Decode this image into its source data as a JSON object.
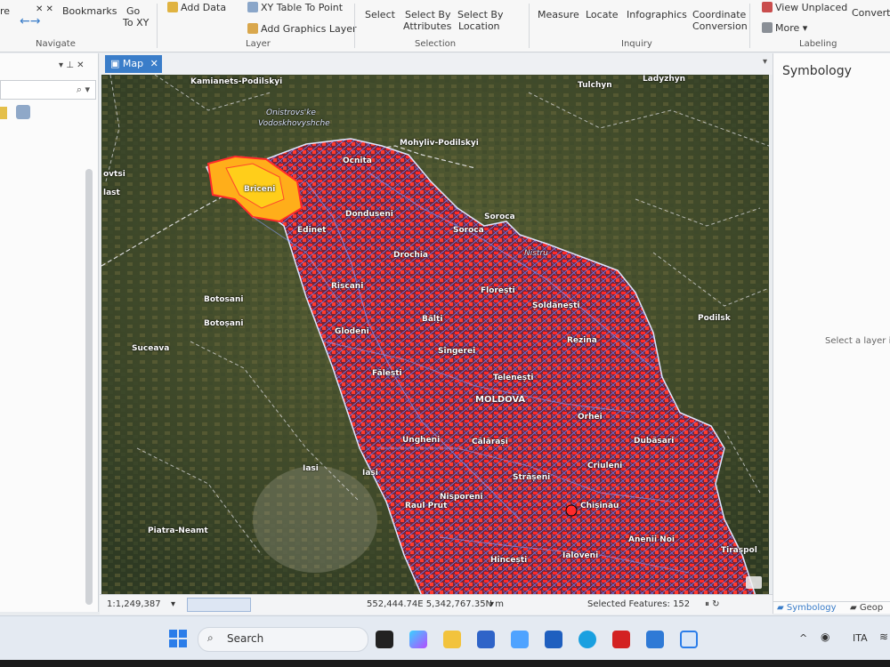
{
  "ribbon": {
    "navigate": {
      "bookmarks": "Bookmarks",
      "go_to_xy_1": "Go",
      "go_to_xy_2": "To XY",
      "group": "Navigate",
      "cut": "re"
    },
    "layer": {
      "add_data": "Add Data",
      "xy_table": "XY Table To Point",
      "add_graphics": "Add Graphics Layer",
      "group": "Layer"
    },
    "selection": {
      "select": "Select",
      "by_attr_1": "Select By",
      "by_attr_2": "Attributes",
      "by_loc_1": "Select By",
      "by_loc_2": "Location",
      "group": "Selection"
    },
    "inquiry": {
      "measure": "Measure",
      "locate": "Locate",
      "infographics": "Infographics",
      "coord_1": "Coordinate",
      "coord_2": "Conversion",
      "group": "Inquiry"
    },
    "labeling": {
      "view_unplaced": "View Unplaced",
      "more": "More",
      "convert": "Convert",
      "group": "Labeling"
    }
  },
  "map_tab": {
    "label": "Map"
  },
  "map_labels": [
    {
      "text": "Kamianets-Podilskyi"
    },
    {
      "text": "Onistrovs'ke"
    },
    {
      "text": "Vodoskhovyshche"
    },
    {
      "text": "Mohyliv-Podilskyi"
    },
    {
      "text": "Tulchyn"
    },
    {
      "text": "Ladyzhyn"
    },
    {
      "text": "Ocnita"
    },
    {
      "text": "Briceni"
    },
    {
      "text": "Donduseni"
    },
    {
      "text": "Soroca"
    },
    {
      "text": "Edinet"
    },
    {
      "text": "Soroca"
    },
    {
      "text": "Nistru"
    },
    {
      "text": "Drochia"
    },
    {
      "text": "Riscani"
    },
    {
      "text": "Florești"
    },
    {
      "text": "Șoldănești"
    },
    {
      "text": "Botosani"
    },
    {
      "text": "Botoșani"
    },
    {
      "text": "Bălți"
    },
    {
      "text": "Glodeni"
    },
    {
      "text": "Rezina"
    },
    {
      "text": "Podilsk"
    },
    {
      "text": "Suceava"
    },
    {
      "text": "Sîngerei"
    },
    {
      "text": "Fălești"
    },
    {
      "text": "Telenești"
    },
    {
      "text": "MOLDOVA"
    },
    {
      "text": "Orhei"
    },
    {
      "text": "Ungheni"
    },
    {
      "text": "Călărași"
    },
    {
      "text": "Dubăsari"
    },
    {
      "text": "Iasi"
    },
    {
      "text": "Iasi"
    },
    {
      "text": "Criuleni"
    },
    {
      "text": "Strășeni"
    },
    {
      "text": "Nisporeni"
    },
    {
      "text": "Raul Prut"
    },
    {
      "text": "Chișinău"
    },
    {
      "text": "Piatra-Neamt"
    },
    {
      "text": "Anenii Noi"
    },
    {
      "text": "Tiraspol"
    },
    {
      "text": "Hîncești"
    },
    {
      "text": "Ialoveni"
    },
    {
      "text": "ovtsi"
    },
    {
      "text": "last"
    }
  ],
  "status": {
    "scale": "1:1,249,387",
    "coords": "552,444.74E 5,342,767.35N m",
    "selected": "Selected Features: 152"
  },
  "right_pane": {
    "title": "Symbology",
    "hint": "Select a layer in",
    "tab_symbology": "Symbology",
    "tab_geo": "Geop"
  },
  "taskbar": {
    "search": "Search",
    "lang": "ITA"
  },
  "colors": {
    "accent": "#3a7dc9",
    "boundary": "#5b7bff",
    "hotspot": "#ff2a2a",
    "hotspot_yellow": "#ffd21a"
  }
}
